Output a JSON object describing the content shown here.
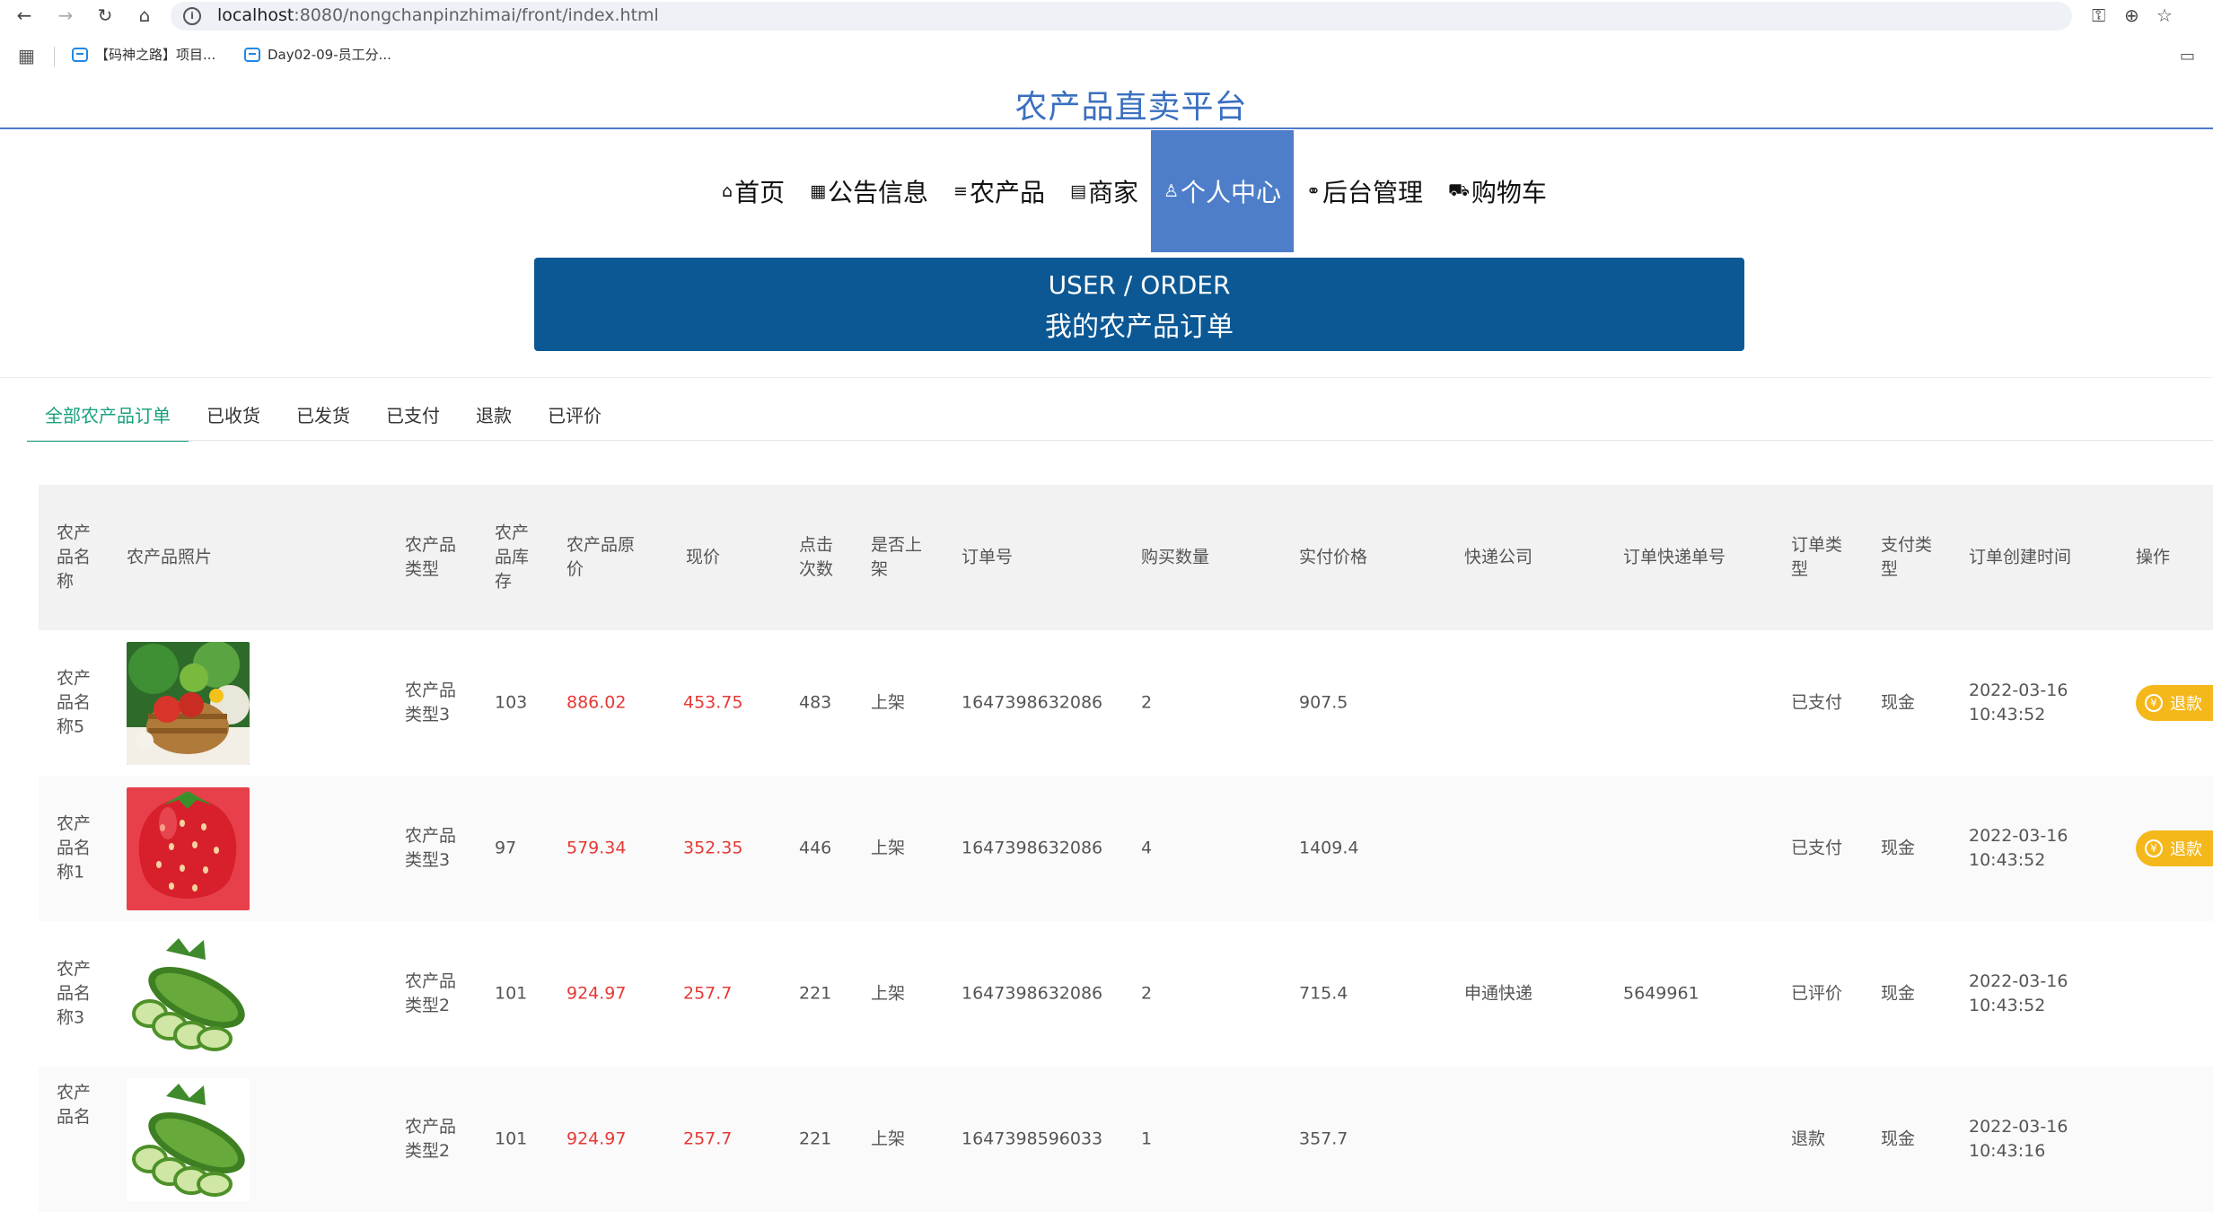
{
  "browser": {
    "url_host": "localhost",
    "url_path": ":8080/nongchanpinzhimai/front/index.html",
    "bookmarks": [
      "【码神之路】项目...",
      "Day02-09-员工分..."
    ]
  },
  "site": {
    "title": "农产品直卖平台"
  },
  "nav": {
    "items": [
      {
        "icon": "⌂",
        "label": "首页"
      },
      {
        "icon": "▦",
        "label": "公告信息"
      },
      {
        "icon": "≡",
        "label": "农产品"
      },
      {
        "icon": "▤",
        "label": "商家"
      },
      {
        "icon": "♙",
        "label": "个人中心"
      },
      {
        "icon": "⚭",
        "label": "后台管理"
      },
      {
        "icon": "⛟",
        "label": "购物车"
      }
    ],
    "active": "个人中心"
  },
  "banner": {
    "en": "USER / ORDER",
    "cn": "我的农产品订单"
  },
  "tabs": [
    "全部农产品订单",
    "已收货",
    "已发货",
    "已支付",
    "退款",
    "已评价"
  ],
  "table": {
    "headers": [
      "农产品名称",
      "农产品照片",
      "农产品类型",
      "农产品库存",
      "农产品原价",
      "现价",
      "点击次数",
      "是否上架",
      "订单号",
      "购买数量",
      "实付价格",
      "快递公司",
      "订单快递单号",
      "订单类型",
      "支付类型",
      "订单创建时间",
      "操作"
    ],
    "rows": [
      {
        "name": "农产品名称5",
        "photo": "vegetables-basket",
        "type": "农产品类型3",
        "stock": "103",
        "orig_price": "886.02",
        "price": "453.75",
        "clicks": "483",
        "listed": "上架",
        "order_no": "1647398632086",
        "qty": "2",
        "paid": "907.5",
        "courier": "",
        "tracking": "",
        "status": "已支付",
        "pay_type": "现金",
        "date": "2022-03-16",
        "time": "10:43:52",
        "action": "退款"
      },
      {
        "name": "农产品名称1",
        "photo": "strawberry",
        "type": "农产品类型3",
        "stock": "97",
        "orig_price": "579.34",
        "price": "352.35",
        "clicks": "446",
        "listed": "上架",
        "order_no": "1647398632086",
        "qty": "4",
        "paid": "1409.4",
        "courier": "",
        "tracking": "",
        "status": "已支付",
        "pay_type": "现金",
        "date": "2022-03-16",
        "time": "10:43:52",
        "action": "退款"
      },
      {
        "name": "农产品名称3",
        "photo": "cucumber",
        "type": "农产品类型2",
        "stock": "101",
        "orig_price": "924.97",
        "price": "257.7",
        "clicks": "221",
        "listed": "上架",
        "order_no": "1647398632086",
        "qty": "2",
        "paid": "715.4",
        "courier": "申通快递",
        "tracking": "5649961",
        "status": "已评价",
        "pay_type": "现金",
        "date": "2022-03-16",
        "time": "10:43:52",
        "action": ""
      },
      {
        "name": "农产品名",
        "photo": "cucumber",
        "type": "农产品类型2",
        "stock": "101",
        "orig_price": "924.97",
        "price": "257.7",
        "clicks": "221",
        "listed": "上架",
        "order_no": "1647398596033",
        "qty": "1",
        "paid": "357.7",
        "courier": "",
        "tracking": "",
        "status": "退款",
        "pay_type": "现金",
        "date": "2022-03-16",
        "time": "10:43:16",
        "action": ""
      }
    ]
  }
}
